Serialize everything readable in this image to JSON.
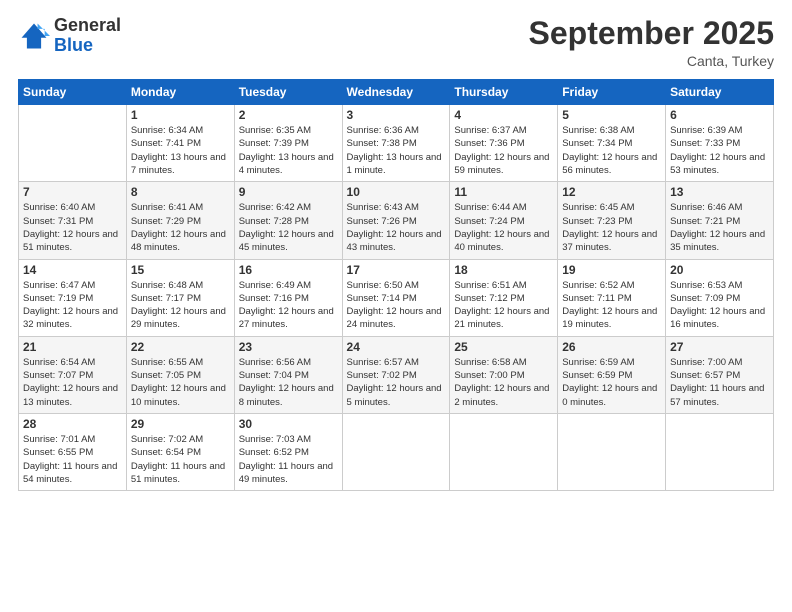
{
  "logo": {
    "general": "General",
    "blue": "Blue"
  },
  "header": {
    "month": "September 2025",
    "location": "Canta, Turkey"
  },
  "weekdays": [
    "Sunday",
    "Monday",
    "Tuesday",
    "Wednesday",
    "Thursday",
    "Friday",
    "Saturday"
  ],
  "weeks": [
    [
      {
        "day": null
      },
      {
        "day": "1",
        "sunrise": "Sunrise: 6:34 AM",
        "sunset": "Sunset: 7:41 PM",
        "daylight": "Daylight: 13 hours and 7 minutes."
      },
      {
        "day": "2",
        "sunrise": "Sunrise: 6:35 AM",
        "sunset": "Sunset: 7:39 PM",
        "daylight": "Daylight: 13 hours and 4 minutes."
      },
      {
        "day": "3",
        "sunrise": "Sunrise: 6:36 AM",
        "sunset": "Sunset: 7:38 PM",
        "daylight": "Daylight: 13 hours and 1 minute."
      },
      {
        "day": "4",
        "sunrise": "Sunrise: 6:37 AM",
        "sunset": "Sunset: 7:36 PM",
        "daylight": "Daylight: 12 hours and 59 minutes."
      },
      {
        "day": "5",
        "sunrise": "Sunrise: 6:38 AM",
        "sunset": "Sunset: 7:34 PM",
        "daylight": "Daylight: 12 hours and 56 minutes."
      },
      {
        "day": "6",
        "sunrise": "Sunrise: 6:39 AM",
        "sunset": "Sunset: 7:33 PM",
        "daylight": "Daylight: 12 hours and 53 minutes."
      }
    ],
    [
      {
        "day": "7",
        "sunrise": "Sunrise: 6:40 AM",
        "sunset": "Sunset: 7:31 PM",
        "daylight": "Daylight: 12 hours and 51 minutes."
      },
      {
        "day": "8",
        "sunrise": "Sunrise: 6:41 AM",
        "sunset": "Sunset: 7:29 PM",
        "daylight": "Daylight: 12 hours and 48 minutes."
      },
      {
        "day": "9",
        "sunrise": "Sunrise: 6:42 AM",
        "sunset": "Sunset: 7:28 PM",
        "daylight": "Daylight: 12 hours and 45 minutes."
      },
      {
        "day": "10",
        "sunrise": "Sunrise: 6:43 AM",
        "sunset": "Sunset: 7:26 PM",
        "daylight": "Daylight: 12 hours and 43 minutes."
      },
      {
        "day": "11",
        "sunrise": "Sunrise: 6:44 AM",
        "sunset": "Sunset: 7:24 PM",
        "daylight": "Daylight: 12 hours and 40 minutes."
      },
      {
        "day": "12",
        "sunrise": "Sunrise: 6:45 AM",
        "sunset": "Sunset: 7:23 PM",
        "daylight": "Daylight: 12 hours and 37 minutes."
      },
      {
        "day": "13",
        "sunrise": "Sunrise: 6:46 AM",
        "sunset": "Sunset: 7:21 PM",
        "daylight": "Daylight: 12 hours and 35 minutes."
      }
    ],
    [
      {
        "day": "14",
        "sunrise": "Sunrise: 6:47 AM",
        "sunset": "Sunset: 7:19 PM",
        "daylight": "Daylight: 12 hours and 32 minutes."
      },
      {
        "day": "15",
        "sunrise": "Sunrise: 6:48 AM",
        "sunset": "Sunset: 7:17 PM",
        "daylight": "Daylight: 12 hours and 29 minutes."
      },
      {
        "day": "16",
        "sunrise": "Sunrise: 6:49 AM",
        "sunset": "Sunset: 7:16 PM",
        "daylight": "Daylight: 12 hours and 27 minutes."
      },
      {
        "day": "17",
        "sunrise": "Sunrise: 6:50 AM",
        "sunset": "Sunset: 7:14 PM",
        "daylight": "Daylight: 12 hours and 24 minutes."
      },
      {
        "day": "18",
        "sunrise": "Sunrise: 6:51 AM",
        "sunset": "Sunset: 7:12 PM",
        "daylight": "Daylight: 12 hours and 21 minutes."
      },
      {
        "day": "19",
        "sunrise": "Sunrise: 6:52 AM",
        "sunset": "Sunset: 7:11 PM",
        "daylight": "Daylight: 12 hours and 19 minutes."
      },
      {
        "day": "20",
        "sunrise": "Sunrise: 6:53 AM",
        "sunset": "Sunset: 7:09 PM",
        "daylight": "Daylight: 12 hours and 16 minutes."
      }
    ],
    [
      {
        "day": "21",
        "sunrise": "Sunrise: 6:54 AM",
        "sunset": "Sunset: 7:07 PM",
        "daylight": "Daylight: 12 hours and 13 minutes."
      },
      {
        "day": "22",
        "sunrise": "Sunrise: 6:55 AM",
        "sunset": "Sunset: 7:05 PM",
        "daylight": "Daylight: 12 hours and 10 minutes."
      },
      {
        "day": "23",
        "sunrise": "Sunrise: 6:56 AM",
        "sunset": "Sunset: 7:04 PM",
        "daylight": "Daylight: 12 hours and 8 minutes."
      },
      {
        "day": "24",
        "sunrise": "Sunrise: 6:57 AM",
        "sunset": "Sunset: 7:02 PM",
        "daylight": "Daylight: 12 hours and 5 minutes."
      },
      {
        "day": "25",
        "sunrise": "Sunrise: 6:58 AM",
        "sunset": "Sunset: 7:00 PM",
        "daylight": "Daylight: 12 hours and 2 minutes."
      },
      {
        "day": "26",
        "sunrise": "Sunrise: 6:59 AM",
        "sunset": "Sunset: 6:59 PM",
        "daylight": "Daylight: 12 hours and 0 minutes."
      },
      {
        "day": "27",
        "sunrise": "Sunrise: 7:00 AM",
        "sunset": "Sunset: 6:57 PM",
        "daylight": "Daylight: 11 hours and 57 minutes."
      }
    ],
    [
      {
        "day": "28",
        "sunrise": "Sunrise: 7:01 AM",
        "sunset": "Sunset: 6:55 PM",
        "daylight": "Daylight: 11 hours and 54 minutes."
      },
      {
        "day": "29",
        "sunrise": "Sunrise: 7:02 AM",
        "sunset": "Sunset: 6:54 PM",
        "daylight": "Daylight: 11 hours and 51 minutes."
      },
      {
        "day": "30",
        "sunrise": "Sunrise: 7:03 AM",
        "sunset": "Sunset: 6:52 PM",
        "daylight": "Daylight: 11 hours and 49 minutes."
      },
      {
        "day": null
      },
      {
        "day": null
      },
      {
        "day": null
      },
      {
        "day": null
      }
    ]
  ]
}
